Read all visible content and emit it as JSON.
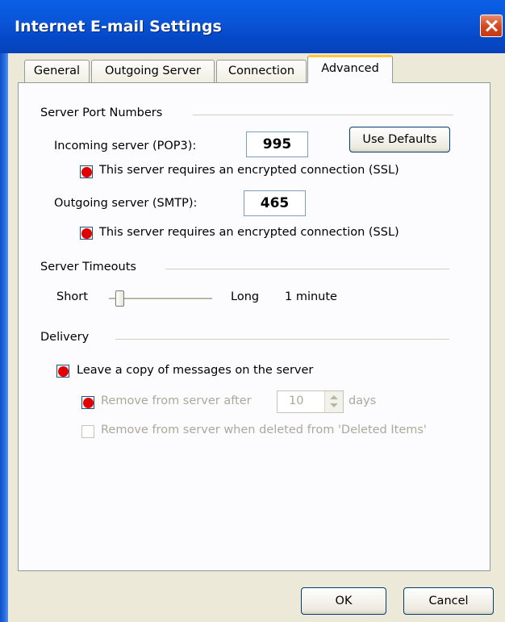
{
  "window": {
    "title": "Internet E-mail Settings"
  },
  "tabs": [
    {
      "label": "General"
    },
    {
      "label": "Outgoing Server"
    },
    {
      "label": "Connection"
    },
    {
      "label": "Advanced",
      "active": true
    }
  ],
  "ports": {
    "section_label": "Server Port Numbers",
    "incoming_label": "Incoming server (POP3):",
    "incoming_value": "995",
    "use_defaults_label": "Use Defaults",
    "incoming_ssl_label": "This server requires an encrypted connection (SSL)",
    "outgoing_label": "Outgoing server (SMTP):",
    "outgoing_value": "465",
    "outgoing_ssl_label": "This server requires an encrypted connection (SSL)"
  },
  "timeouts": {
    "section_label": "Server Timeouts",
    "short_label": "Short",
    "long_label": "Long",
    "value_label": "1 minute"
  },
  "delivery": {
    "section_label": "Delivery",
    "leave_copy_label": "Leave a copy of messages on the server",
    "remove_after_label": "Remove from server after",
    "remove_after_value": "10",
    "days_label": "days",
    "remove_deleted_label": "Remove from server when deleted from 'Deleted Items'"
  },
  "buttons": {
    "ok_label": "OK",
    "cancel_label": "Cancel"
  },
  "colors": {
    "titlebar": "#0a55d8",
    "accent_tab": "#ffc83c",
    "check_mark": "#e00000"
  }
}
